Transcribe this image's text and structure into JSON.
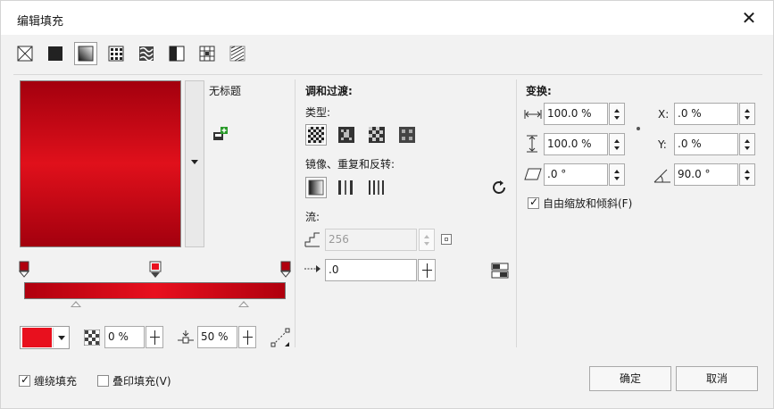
{
  "window": {
    "title": "编辑填充",
    "close_glyph": "✕"
  },
  "fill_types": [
    {
      "name": "no-fill-icon",
      "active": false
    },
    {
      "name": "uniform-fill-icon",
      "active": false
    },
    {
      "name": "fountain-fill-icon",
      "active": true
    },
    {
      "name": "vector-pattern-fill-icon",
      "active": false
    },
    {
      "name": "bitmap-pattern-fill-icon",
      "active": false
    },
    {
      "name": "two-color-pattern-fill-icon",
      "active": false
    },
    {
      "name": "texture-fill-icon",
      "active": false
    },
    {
      "name": "postscript-fill-icon",
      "active": false
    }
  ],
  "preview": {
    "name": "无标题",
    "color_dark": "#a3000e",
    "color_light": "#e0101b"
  },
  "gradient": {
    "node_color": "#e8101e",
    "opacity": "0 %",
    "midpoint": "50 %"
  },
  "blend": {
    "heading": "调和过渡:",
    "type_label": "类型:",
    "mirror_label": "镜像、重复和反转:",
    "flow_label": "流:",
    "steps": "256",
    "acceleration": ".0"
  },
  "transform": {
    "heading": "变换:",
    "width": "100.0 %",
    "height": "100.0 %",
    "skew": ".0 °",
    "x_label": "X:",
    "x": ".0 %",
    "y_label": "Y:",
    "y": ".0 %",
    "rotation": "90.0 °",
    "free_scale_label": "自由缩放和倾斜(F)",
    "free_scale_checked": true
  },
  "footer": {
    "wrap_fill_label": "缠绕填充",
    "wrap_fill_checked": true,
    "overprint_label": "叠印填充(V)",
    "overprint_checked": false,
    "ok_label": "确定",
    "cancel_label": "取消"
  }
}
